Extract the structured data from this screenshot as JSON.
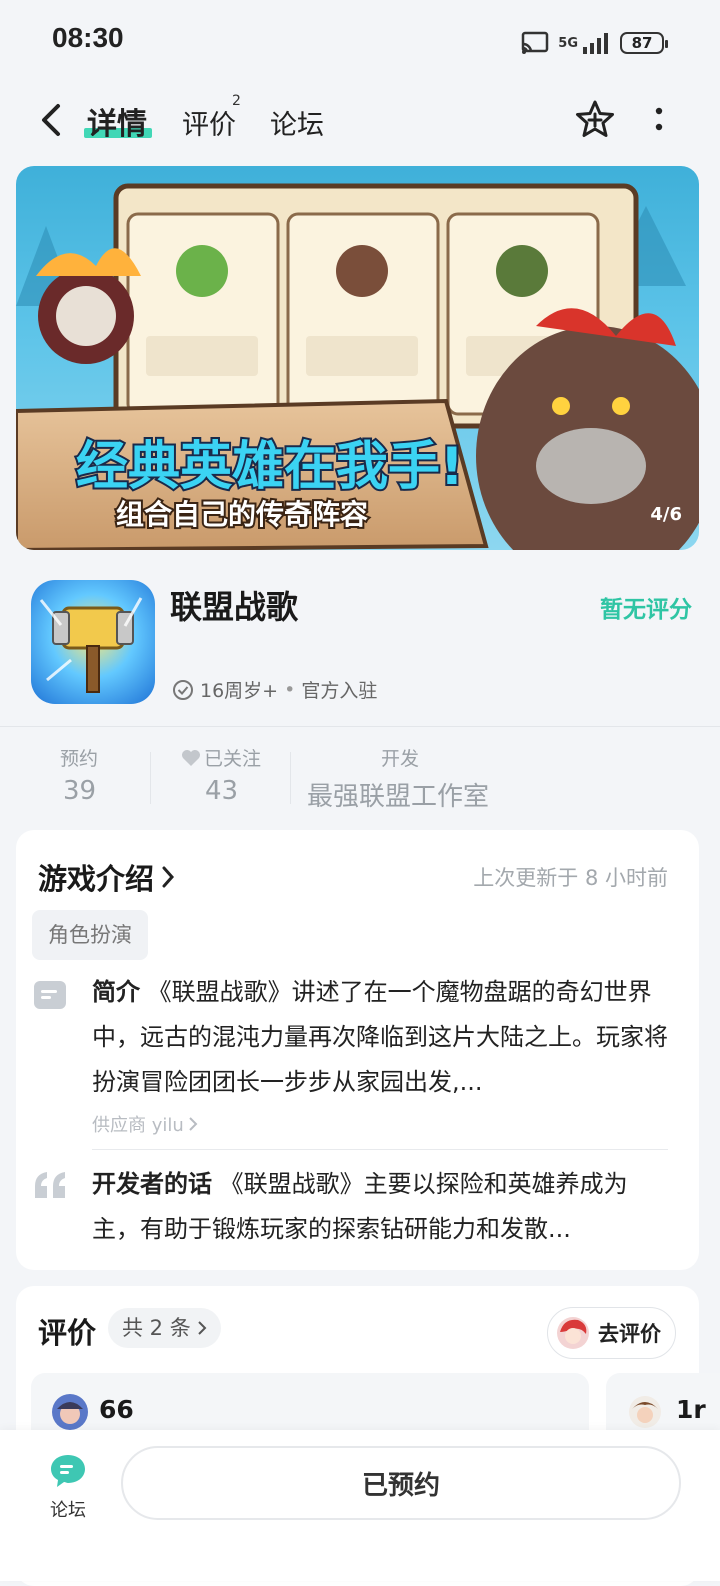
{
  "status_bar": {
    "time": "08:30",
    "network": "5G",
    "battery": "87"
  },
  "nav": {
    "tabs": [
      {
        "label": "详情",
        "active": true
      },
      {
        "label": "评价",
        "badge": "2"
      },
      {
        "label": "论坛"
      }
    ]
  },
  "banner": {
    "counter": "4/6",
    "headline": "经典英雄在我手!",
    "subline": "组合自己的传奇阵容"
  },
  "app": {
    "name": "联盟战歌",
    "rating": "暂无评分",
    "age": "16周岁+",
    "official": "官方入驻"
  },
  "stats": {
    "reserve": {
      "label": "预约",
      "value": "39"
    },
    "follow": {
      "label": "已关注",
      "value": "43"
    },
    "developer": {
      "label": "开发",
      "value": "最强联盟工作室"
    }
  },
  "intro": {
    "title": "游戏介绍",
    "update": "上次更新于 8 小时前",
    "tag": "角色扮演",
    "summary_label": "简介",
    "summary": "《联盟战歌》讲述了在一个魔物盘踞的奇幻世界中，远古的混沌力量再次降临到这片大陆之上。玩家将扮演冒险团团长一步步从家园出发,...",
    "supplier": "供应商 yilu",
    "dev_label": "开发者的话",
    "dev_words": "《联盟战歌》主要以探险和英雄养成为主，有助于锻炼玩家的探索钻研能力和发散..."
  },
  "reviews": {
    "title": "评价",
    "count": "共 2 条",
    "go_review": "去评价",
    "items": [
      {
        "user": "66"
      },
      {
        "user": "1r"
      }
    ]
  },
  "bottom": {
    "forum_label": "论坛",
    "reserve_button": "已预约"
  },
  "colors": {
    "accent": "#2fc5a4",
    "background": "#f3f5f8"
  }
}
